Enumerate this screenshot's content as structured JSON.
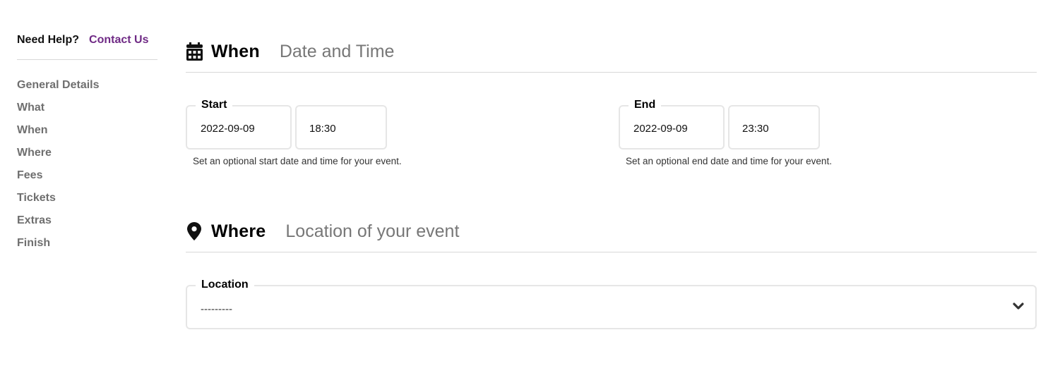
{
  "sidebar": {
    "help_label": "Need Help?",
    "contact_link": "Contact Us",
    "contact_color": "#6f2a85",
    "nav_items": [
      {
        "label": "General Details"
      },
      {
        "label": "What"
      },
      {
        "label": "When"
      },
      {
        "label": "Where"
      },
      {
        "label": "Fees"
      },
      {
        "label": "Tickets"
      },
      {
        "label": "Extras"
      },
      {
        "label": "Finish"
      }
    ]
  },
  "when": {
    "icon": "calendar-icon",
    "title": "When",
    "subtitle": "Date and Time",
    "start": {
      "legend": "Start",
      "date": "2022-09-09",
      "time": "18:30",
      "help": "Set an optional start date and time for your event."
    },
    "end": {
      "legend": "End",
      "date": "2022-09-09",
      "time": "23:30",
      "help": "Set an optional end date and time for your event."
    }
  },
  "where": {
    "icon": "map-pin-icon",
    "title": "Where",
    "subtitle": "Location of your event",
    "location": {
      "legend": "Location",
      "selected": "---------",
      "icon": "chevron-down-icon"
    }
  }
}
